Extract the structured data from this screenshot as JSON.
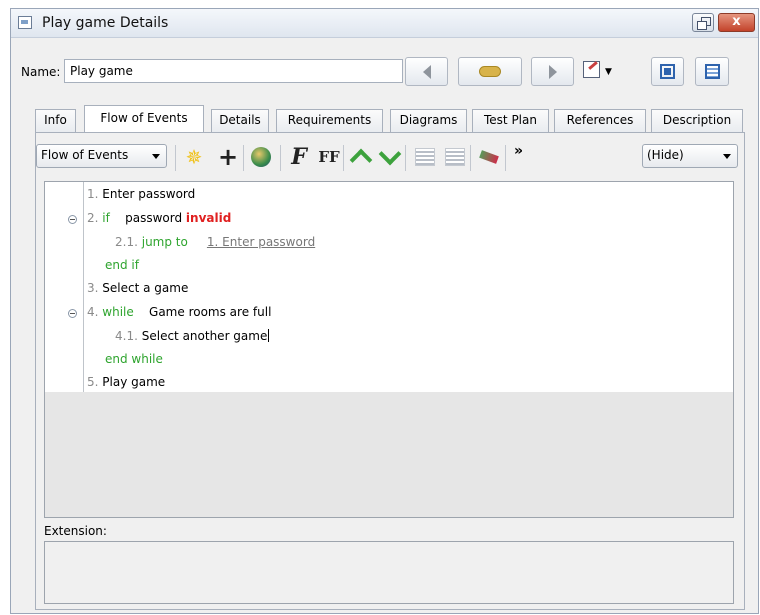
{
  "window": {
    "title": "Play game Details",
    "close_glyph": "x"
  },
  "name_field": {
    "label": "Name:",
    "value": "Play game"
  },
  "tabs": [
    {
      "label": "Info"
    },
    {
      "label": "Flow of Events"
    },
    {
      "label": "Details"
    },
    {
      "label": "Requirements"
    },
    {
      "label": "Diagrams"
    },
    {
      "label": "Test Plan"
    },
    {
      "label": "References"
    },
    {
      "label": "Description"
    }
  ],
  "toolbar": {
    "view_select": "Flow of Events",
    "more_glyph": "»",
    "hide_select": "(Hide)"
  },
  "flow": {
    "s1": {
      "num": "1.",
      "text": "Enter password"
    },
    "s2": {
      "num": "2.",
      "keyword": "if",
      "text": "password",
      "highlight": "invalid"
    },
    "s21": {
      "num": "2.1.",
      "keyword": "jump to",
      "link": "1. Enter password"
    },
    "s2_end": "end if",
    "s3": {
      "num": "3.",
      "text": "Select a game"
    },
    "s4": {
      "num": "4.",
      "keyword": "while",
      "text": "Game rooms are full"
    },
    "s41": {
      "num": "4.1.",
      "text": "Select another game"
    },
    "s4_end": "end while",
    "s5": {
      "num": "5.",
      "text": "Play game"
    }
  },
  "extension": {
    "label": "Extension:"
  },
  "colors": {
    "keyword": "#2ea42e",
    "highlight": "#e02020",
    "window_bg": "#f0f0f0"
  },
  "icons": [
    "app-icon",
    "restore-icon",
    "close-icon",
    "back-arrow-icon",
    "jump-icon",
    "forward-arrow-icon",
    "edit-icon",
    "window-icon",
    "table-icon",
    "star-icon",
    "plus-icon",
    "globe-icon",
    "format-icon",
    "format-all-icon",
    "move-up-icon",
    "move-down-icon",
    "outdent-icon",
    "indent-icon",
    "flag-icon"
  ]
}
